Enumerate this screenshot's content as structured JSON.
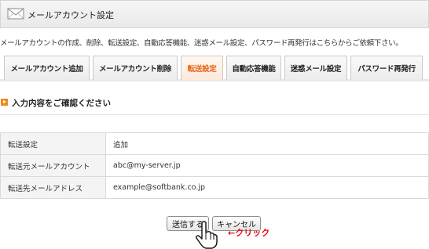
{
  "header": {
    "title": "メールアカウント設定",
    "icon": "mail-envelope-icon"
  },
  "description": "メールアカウントの作成、削除、転送設定、自動応答機能、迷惑メール設定、パスワード再発行はこちらからご依頼下さい。",
  "tabs": [
    {
      "label": "メールアカウント追加",
      "active": false
    },
    {
      "label": "メールアカウント削除",
      "active": false
    },
    {
      "label": "転送設定",
      "active": true
    },
    {
      "label": "自動応答機能",
      "active": false
    },
    {
      "label": "迷惑メール設定",
      "active": false
    },
    {
      "label": "パスワード再発行",
      "active": false
    }
  ],
  "section": {
    "title": "入力内容をご確認ください"
  },
  "confirm_table": [
    {
      "label": "転送設定",
      "value": "追加"
    },
    {
      "label": "転送元メールアカウント",
      "value": "abc@my-server.jp"
    },
    {
      "label": "転送先メールアドレス",
      "value": "example@softbank.co.jp"
    }
  ],
  "buttons": {
    "submit": "送信する",
    "cancel": "キャンセル"
  },
  "annotation": {
    "text": "←クリック",
    "color": "#e0101b"
  },
  "colors": {
    "active_tab": "#e8641b",
    "bullet": "#f08a1c"
  }
}
